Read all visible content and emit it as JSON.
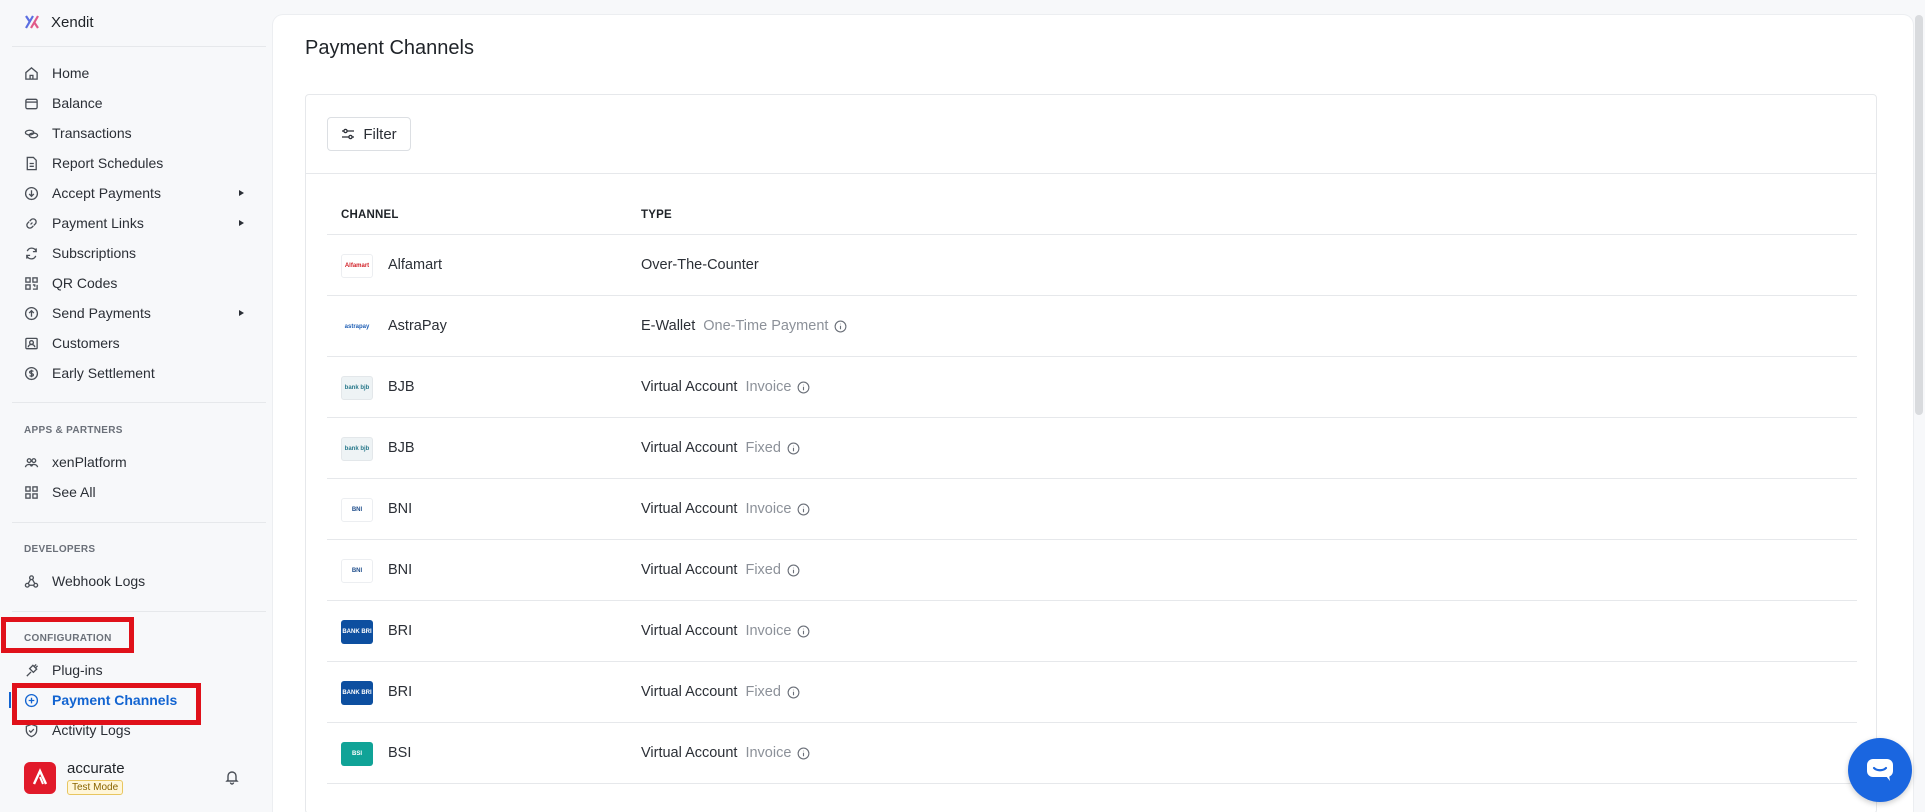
{
  "brand": {
    "name": "Xendit"
  },
  "nav": [
    {
      "label": "Home",
      "icon": "home-icon"
    },
    {
      "label": "Balance",
      "icon": "wallet-icon"
    },
    {
      "label": "Transactions",
      "icon": "coins-icon"
    },
    {
      "label": "Report Schedules",
      "icon": "document-icon"
    },
    {
      "label": "Accept Payments",
      "icon": "download-circle-icon",
      "expandable": true
    },
    {
      "label": "Payment Links",
      "icon": "link-icon",
      "expandable": true
    },
    {
      "label": "Subscriptions",
      "icon": "refresh-icon"
    },
    {
      "label": "QR Codes",
      "icon": "qr-code-icon"
    },
    {
      "label": "Send Payments",
      "icon": "upload-circle-icon",
      "expandable": true
    },
    {
      "label": "Customers",
      "icon": "contact-card-icon"
    },
    {
      "label": "Early Settlement",
      "icon": "dollar-circle-icon"
    }
  ],
  "sections": {
    "apps": {
      "title": "APPS & PARTNERS",
      "items": [
        {
          "label": "xenPlatform",
          "icon": "users-icon"
        },
        {
          "label": "See All",
          "icon": "grid-icon"
        }
      ]
    },
    "developers": {
      "title": "DEVELOPERS",
      "items": [
        {
          "label": "Webhook Logs",
          "icon": "webhook-icon"
        }
      ]
    },
    "configuration": {
      "title": "CONFIGURATION",
      "items": [
        {
          "label": "Plug-ins",
          "icon": "plug-icon"
        },
        {
          "label": "Payment Channels",
          "icon": "plus-circle-icon",
          "active": true
        },
        {
          "label": "Activity Logs",
          "icon": "shield-check-icon"
        }
      ]
    }
  },
  "account": {
    "name": "accurate",
    "mode": "Test Mode"
  },
  "page": {
    "title": "Payment Channels",
    "filter_label": "Filter",
    "columns": {
      "channel": "CHANNEL",
      "type": "TYPE"
    }
  },
  "rows": [
    {
      "channel": "Alfamart",
      "type": "Over-The-Counter",
      "subtype": "",
      "logo": "alfamart"
    },
    {
      "channel": "AstraPay",
      "type": "E-Wallet",
      "subtype": "One-Time Payment",
      "logo": "astrapay"
    },
    {
      "channel": "BJB",
      "type": "Virtual Account",
      "subtype": "Invoice",
      "logo": "bjb"
    },
    {
      "channel": "BJB",
      "type": "Virtual Account",
      "subtype": "Fixed",
      "logo": "bjb"
    },
    {
      "channel": "BNI",
      "type": "Virtual Account",
      "subtype": "Invoice",
      "logo": "bni"
    },
    {
      "channel": "BNI",
      "type": "Virtual Account",
      "subtype": "Fixed",
      "logo": "bni"
    },
    {
      "channel": "BRI",
      "type": "Virtual Account",
      "subtype": "Invoice",
      "logo": "bri"
    },
    {
      "channel": "BRI",
      "type": "Virtual Account",
      "subtype": "Fixed",
      "logo": "bri"
    },
    {
      "channel": "BSI",
      "type": "Virtual Account",
      "subtype": "Invoice",
      "logo": "bsi"
    }
  ],
  "colors": {
    "accent": "#1264d1",
    "highlight": "#e0111a",
    "chat": "#1a66e0"
  }
}
